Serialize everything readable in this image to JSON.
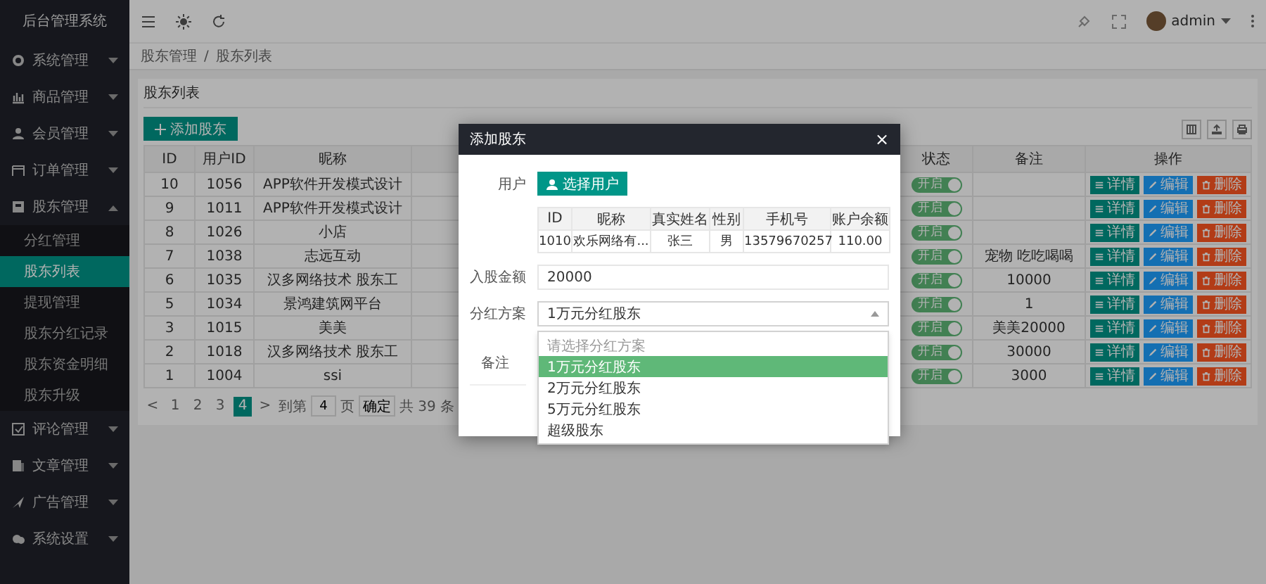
{
  "sidebar": {
    "title": "后台管理系统",
    "items": [
      {
        "label": "系统管理",
        "expanded": false
      },
      {
        "label": "商品管理",
        "expanded": false
      },
      {
        "label": "会员管理",
        "expanded": false
      },
      {
        "label": "订单管理",
        "expanded": false
      },
      {
        "label": "股东管理",
        "expanded": true,
        "children": [
          {
            "label": "分红管理",
            "selected": false
          },
          {
            "label": "股东列表",
            "selected": true
          },
          {
            "label": "提现管理",
            "selected": false
          },
          {
            "label": "股东分红记录",
            "selected": false
          },
          {
            "label": "股东资金明细",
            "selected": false
          },
          {
            "label": "股东升级",
            "selected": false
          }
        ]
      },
      {
        "label": "评论管理",
        "expanded": false
      },
      {
        "label": "文章管理",
        "expanded": false
      },
      {
        "label": "广告管理",
        "expanded": false
      },
      {
        "label": "系统设置",
        "expanded": false
      }
    ]
  },
  "header": {
    "user": "admin"
  },
  "breadcrumb": {
    "items": [
      "股东管理",
      "股东列表"
    ],
    "separator": "/"
  },
  "card": {
    "title": "股东列表",
    "add_button": "添加股东",
    "table": {
      "columns": [
        "ID",
        "用户ID",
        "昵称",
        "状态",
        "备注",
        "操作"
      ],
      "rows": [
        {
          "id": "10",
          "user_id": "1056",
          "nickname": "APP软件开发模式设计",
          "status": {
            "label": "开启",
            "on": true
          },
          "remark": "",
          "actions": [
            {
              "label": "详情",
              "kind": "detail"
            },
            {
              "label": "编辑",
              "kind": "edit"
            },
            {
              "label": "删除",
              "kind": "delete"
            }
          ]
        },
        {
          "id": "9",
          "user_id": "1011",
          "nickname": "APP软件开发模式设计",
          "status": {
            "label": "开启",
            "on": true
          },
          "remark": "",
          "actions": [
            {
              "label": "详情",
              "kind": "detail"
            },
            {
              "label": "编辑",
              "kind": "edit"
            },
            {
              "label": "删除",
              "kind": "delete"
            }
          ]
        },
        {
          "id": "8",
          "user_id": "1026",
          "nickname": "小店",
          "status": {
            "label": "开启",
            "on": true
          },
          "remark": "",
          "actions": [
            {
              "label": "详情",
              "kind": "detail"
            },
            {
              "label": "编辑",
              "kind": "edit"
            },
            {
              "label": "删除",
              "kind": "delete"
            }
          ]
        },
        {
          "id": "7",
          "user_id": "1038",
          "nickname": "志远互动",
          "status": {
            "label": "开启",
            "on": true
          },
          "remark": "宠物 吃吃喝喝",
          "actions": [
            {
              "label": "详情",
              "kind": "detail"
            },
            {
              "label": "编辑",
              "kind": "edit"
            },
            {
              "label": "删除",
              "kind": "delete"
            }
          ]
        },
        {
          "id": "6",
          "user_id": "1035",
          "nickname": "汉多网络技术 股东工",
          "status": {
            "label": "开启",
            "on": true
          },
          "remark": "10000",
          "actions": [
            {
              "label": "详情",
              "kind": "detail"
            },
            {
              "label": "编辑",
              "kind": "edit"
            },
            {
              "label": "删除",
              "kind": "delete"
            }
          ]
        },
        {
          "id": "5",
          "user_id": "1034",
          "nickname": "景鸿建筑网平台",
          "status": {
            "label": "开启",
            "on": true
          },
          "remark": "1",
          "actions": [
            {
              "label": "详情",
              "kind": "detail"
            },
            {
              "label": "编辑",
              "kind": "edit"
            },
            {
              "label": "删除",
              "kind": "delete"
            }
          ]
        },
        {
          "id": "3",
          "user_id": "1015",
          "nickname": "美美",
          "status": {
            "label": "开启",
            "on": true
          },
          "remark": "美美20000",
          "actions": [
            {
              "label": "详情",
              "kind": "detail"
            },
            {
              "label": "编辑",
              "kind": "edit"
            },
            {
              "label": "删除",
              "kind": "delete"
            }
          ]
        },
        {
          "id": "2",
          "user_id": "1018",
          "nickname": "汉多网络技术 股东工",
          "status": {
            "label": "开启",
            "on": true
          },
          "remark": "30000",
          "actions": [
            {
              "label": "详情",
              "kind": "detail"
            },
            {
              "label": "编辑",
              "kind": "edit"
            },
            {
              "label": "删除",
              "kind": "delete"
            }
          ]
        },
        {
          "id": "1",
          "user_id": "1004",
          "nickname": "ssi",
          "status": {
            "label": "开启",
            "on": true
          },
          "remark": "3000",
          "actions": [
            {
              "label": "详情",
              "kind": "detail"
            },
            {
              "label": "编辑",
              "kind": "edit"
            },
            {
              "label": "删除",
              "kind": "delete"
            }
          ]
        }
      ]
    },
    "pagination": {
      "prev": "<",
      "pages": [
        {
          "label": "1",
          "selected": false
        },
        {
          "label": "2",
          "selected": false
        },
        {
          "label": "3",
          "selected": false
        },
        {
          "label": "4",
          "selected": true
        }
      ],
      "next": ">",
      "goto_label": "到第",
      "goto_value": "4",
      "page_unit": "页",
      "confirm": "确定",
      "total": "共 39 条"
    }
  },
  "modal": {
    "title": "添加股东",
    "close": "×",
    "user_label": "用户",
    "select_user_button": "选择用户",
    "user_table": {
      "columns": [
        "ID",
        "昵称",
        "真实姓名",
        "性别",
        "手机号",
        "账户余额"
      ],
      "row": [
        "1010",
        "欢乐网络有...",
        "张三",
        "男",
        "13579670257",
        "110.00"
      ]
    },
    "amount_label": "入股金额",
    "amount_value": "20000",
    "plan_label": "分红方案",
    "plan_value": "1万元分红股东",
    "plan_options": [
      {
        "label": "请选择分红方案",
        "selected": false,
        "kind": "hint"
      },
      {
        "label": "1万元分红股东",
        "selected": true,
        "kind": "option"
      },
      {
        "label": "2万元分红股东",
        "selected": false,
        "kind": "option"
      },
      {
        "label": "5万元分红股东",
        "selected": false,
        "kind": "option"
      },
      {
        "label": "超级股东",
        "selected": false,
        "kind": "option"
      }
    ],
    "remark_label": "备注"
  }
}
